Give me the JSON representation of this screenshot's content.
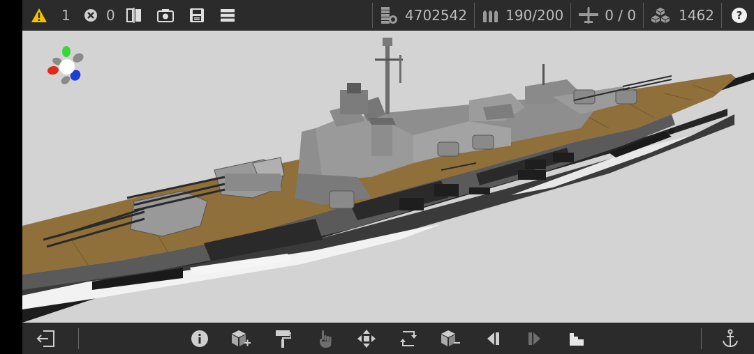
{
  "topbar": {
    "warnings_count": "1",
    "errors_count": "0",
    "cost": "4702542",
    "ammo": "190/200",
    "aircraft": "0 / 0",
    "parts": "1462",
    "help_label": "?"
  },
  "icons": {
    "warning": "warning-icon",
    "error": "error-icon",
    "mirror": "mirror-icon",
    "screenshot": "camera-icon",
    "save": "save-icon",
    "menu": "menu-icon",
    "cost": "cost-icon",
    "ammo": "ammo-icon",
    "aircraft": "aircraft-icon",
    "parts": "parts-icon",
    "help": "help-icon",
    "exit": "exit-icon",
    "info": "info-icon",
    "add_part": "add-part-icon",
    "paint": "paint-roller-icon",
    "select": "hand-icon",
    "move": "move-icon",
    "rotate": "rotate-icon",
    "remove_part": "remove-part-icon",
    "prev": "previous-icon",
    "next": "next-icon",
    "dock": "dock-icon",
    "anchor": "anchor-icon"
  },
  "colors": {
    "bar_bg": "#2b2b2b",
    "viewport_bg": "#d3d3d3",
    "deck": "#8f6f3a",
    "hull_gray": "#8e8e8e",
    "hull_dark": "#3a3a3a",
    "warning": "#f2c200",
    "axis_x": "#e02a1a",
    "axis_y": "#3bd63b",
    "axis_z": "#1a3fd6"
  }
}
